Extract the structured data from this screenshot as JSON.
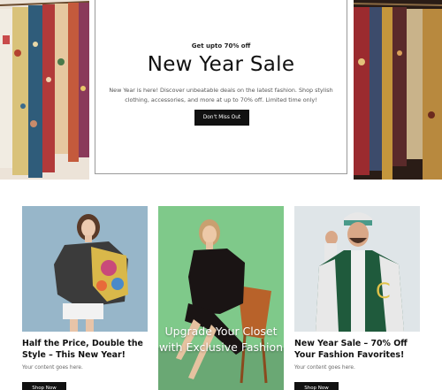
{
  "hero": {
    "eyebrow": "Get upto 70% off",
    "title": "New Year Sale",
    "description": "New Year is here! Discover unbeatable deals on the latest fashion. Shop stylish clothing, accessories, and more at up to 70% off. Limited time only!",
    "cta_label": "Don't Miss Out"
  },
  "cards": [
    {
      "title": "Half the Price, Double the Style – This New Year!",
      "body": "Your content goes here.",
      "cta_label": "Shop Now",
      "background": "#97b6c9"
    },
    {
      "overlay_title": "Upgrade Your Closet with Exclusive Fashion",
      "background": "#7fc98a"
    },
    {
      "title": "New Year Sale – 70% Off Your Fashion Favorites!",
      "body": "Your content goes here.",
      "cta_label": "Shop Now",
      "background": "#dfe5e8"
    }
  ],
  "colors": {
    "button": "#111111",
    "button_text": "#ffffff",
    "card_border": "#9a9a9a"
  }
}
